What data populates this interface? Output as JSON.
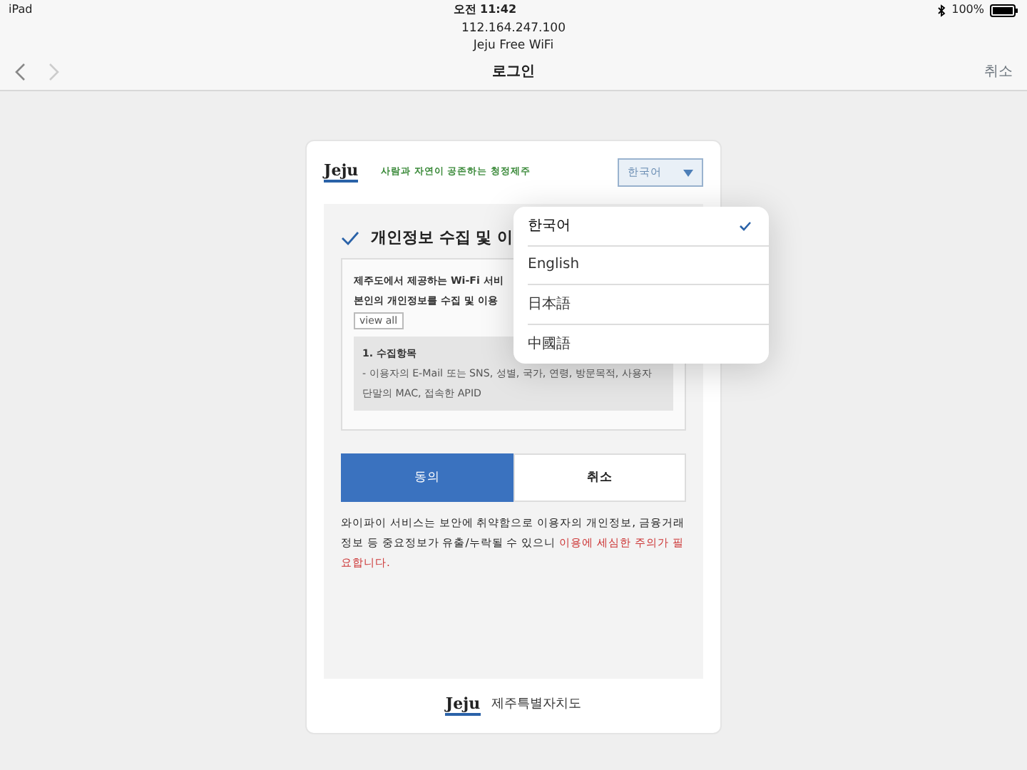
{
  "status_bar": {
    "device": "iPad",
    "time": "오전 11:42",
    "battery": "100%"
  },
  "address": {
    "host": "112.164.247.100",
    "network": "Jeju Free WiFi"
  },
  "nav": {
    "title": "로그인",
    "cancel": "취소"
  },
  "header": {
    "logo": "Jeju",
    "slogan": "사람과 자연이 공존하는 청정제주",
    "language_select": "한국어"
  },
  "consent": {
    "heading": "개인정보 수집 및 이",
    "checked": true,
    "intro_lines": [
      "제주도에서 제공하는 Wi-Fi 서비",
      "본인의 개인정보를 수집 및 이용"
    ],
    "view_all": "view all",
    "section_title": "1. 수집항목",
    "section_text": "- 이용자의 E-Mail 또는 SNS, 성별, 국가, 연령, 방문목적, 사용자 단말의 MAC, 접속한 APID"
  },
  "buttons": [
    {
      "label": "동의",
      "kind": "primary"
    },
    {
      "label": "취소",
      "kind": "secondary"
    }
  ],
  "warning": {
    "text": "와이파이 서비스는 보안에 취약함으로 이용자의 개인정보, 금융거래정보 등 중요정보가 유출/누락될 수 있으니 ",
    "highlight": "이용에 세심한 주의가 필요합니다."
  },
  "footer": {
    "logo": "Jeju",
    "org": "제주특별자치도"
  },
  "language_menu": [
    {
      "label": "한국어",
      "selected": true
    },
    {
      "label": "English",
      "selected": false
    },
    {
      "label": "日本語",
      "selected": false
    },
    {
      "label": "中國語",
      "selected": false
    }
  ]
}
